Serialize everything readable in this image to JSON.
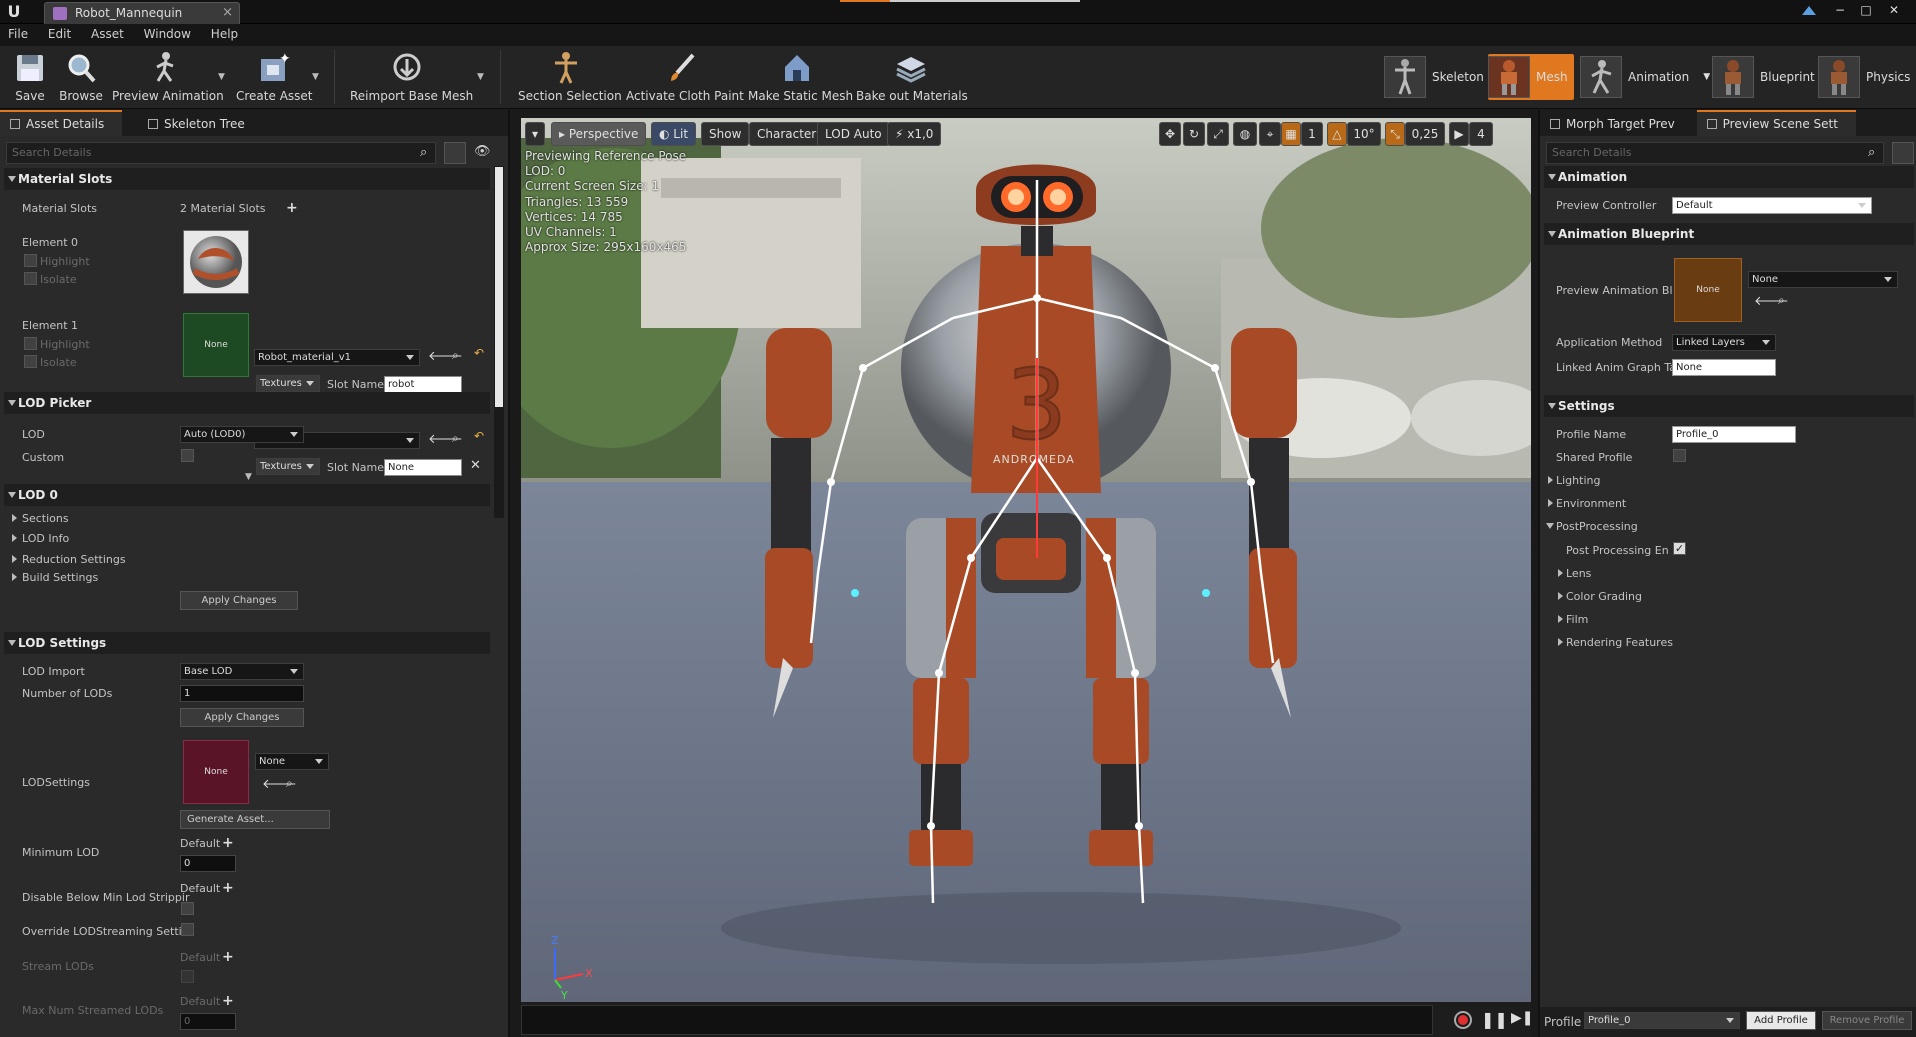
{
  "window": {
    "tab_title": "Robot_Mannequin",
    "tab_close": "×",
    "min": "−",
    "max": "□",
    "close": "✕"
  },
  "menu": [
    "File",
    "Edit",
    "Asset",
    "Window",
    "Help"
  ],
  "toolbar": {
    "save": "Save",
    "browse": "Browse",
    "preview_animation": "Preview Animation",
    "create_asset": "Create Asset",
    "reimport_base_mesh": "Reimport Base Mesh",
    "section_selection": "Section Selection",
    "activate_cloth_paint": "Activate Cloth Paint",
    "make_static_mesh": "Make Static Mesh",
    "bake_out_materials": "Bake out Materials"
  },
  "modes": {
    "skeleton": "Skeleton",
    "mesh": "Mesh",
    "animation": "Animation",
    "blueprint": "Blueprint",
    "physics": "Physics"
  },
  "left": {
    "tabs": [
      "Asset Details",
      "Skeleton Tree"
    ],
    "search_placeholder": "Search Details",
    "material_slots": {
      "header": "Material Slots",
      "label": "Material Slots",
      "count": "2 Material Slots",
      "element0": {
        "label": "Element 0",
        "highlight": "Highlight",
        "isolate": "Isolate",
        "material": "Robot_material_v1",
        "textures": "Textures",
        "slot_name_label": "Slot Name",
        "slot_name": "robot"
      },
      "element1": {
        "label": "Element 1",
        "highlight": "Highlight",
        "isolate": "Isolate",
        "thumb": "None",
        "material": "None",
        "textures": "Textures",
        "slot_name_label": "Slot Name",
        "slot_name": "None"
      }
    },
    "lod_picker": {
      "header": "LOD Picker",
      "lod_label": "LOD",
      "lod_value": "Auto (LOD0)",
      "custom_label": "Custom"
    },
    "lod0": {
      "header": "LOD 0",
      "items": [
        "Sections",
        "LOD Info",
        "Reduction Settings",
        "Build Settings"
      ],
      "apply": "Apply Changes"
    },
    "lod_settings": {
      "header": "LOD Settings",
      "lod_import_label": "LOD Import",
      "lod_import": "Base LOD",
      "num_lods_label": "Number of LODs",
      "num_lods": "1",
      "apply": "Apply Changes",
      "lodsettings_label": "LODSettings",
      "lodsettings_thumb": "None",
      "lodsettings_value": "None",
      "generate": "Generate Asset...",
      "min_lod_label": "Minimum LOD",
      "min_lod_default": "Default",
      "min_lod": "0",
      "disable_below_label": "Disable Below Min Lod Strippir",
      "disable_below_default": "Default",
      "override_label": "Override LODStreaming Settin",
      "stream_lods_label": "Stream LODs",
      "stream_lods_default": "Default",
      "max_streamed_label": "Max Num Streamed LODs",
      "max_streamed_default": "Default",
      "max_streamed": "0"
    }
  },
  "viewport": {
    "buttons": {
      "perspective": "Perspective",
      "lit": "Lit",
      "show": "Show",
      "character": "Character",
      "lod_auto": "LOD Auto",
      "speed": "x1,0"
    },
    "right_buttons": {
      "grid": "1",
      "angle": "10°",
      "scale": "0,25",
      "cam": "4"
    },
    "stats": [
      "Previewing Reference Pose",
      "LOD: 0",
      "Current Screen Size: 1",
      "Triangles: 13 559",
      "Vertices: 14 785",
      "UV Channels: 1",
      "Approx Size: 295x160x465"
    ],
    "robot_number": "3",
    "robot_text": "ANDROMEDA",
    "axis": {
      "z": "Z",
      "x": "X",
      "y": "Y"
    }
  },
  "right": {
    "tabs": [
      "Morph Target Prev",
      "Preview Scene Sett"
    ],
    "search_placeholder": "Search Details",
    "animation": {
      "header": "Animation",
      "controller_label": "Preview Controller",
      "controller": "Default"
    },
    "anim_bp": {
      "header": "Animation Blueprint",
      "preview_label": "Preview Animation Bl",
      "thumb": "None",
      "value": "None",
      "method_label": "Application Method",
      "method": "Linked Layers",
      "linked_label": "Linked Anim Graph Ta",
      "linked": "None"
    },
    "settings": {
      "header": "Settings",
      "profile_name_label": "Profile Name",
      "profile_name": "Profile_0",
      "shared_label": "Shared Profile",
      "lighting": "Lighting",
      "environment": "Environment",
      "postprocessing": "PostProcessing",
      "pp_enabled": "Post Processing En",
      "lens": "Lens",
      "color_grading": "Color Grading",
      "film": "Film",
      "rendering": "Rendering Features"
    },
    "footer": {
      "profile_label": "Profile",
      "profile": "Profile_0",
      "add": "Add Profile",
      "remove": "Remove Profile"
    }
  },
  "colors": {
    "accent": "#e07820",
    "panel": "#2a2a2a",
    "robot_orange": "#a84a26",
    "robot_grey": "#9aa0a6"
  }
}
